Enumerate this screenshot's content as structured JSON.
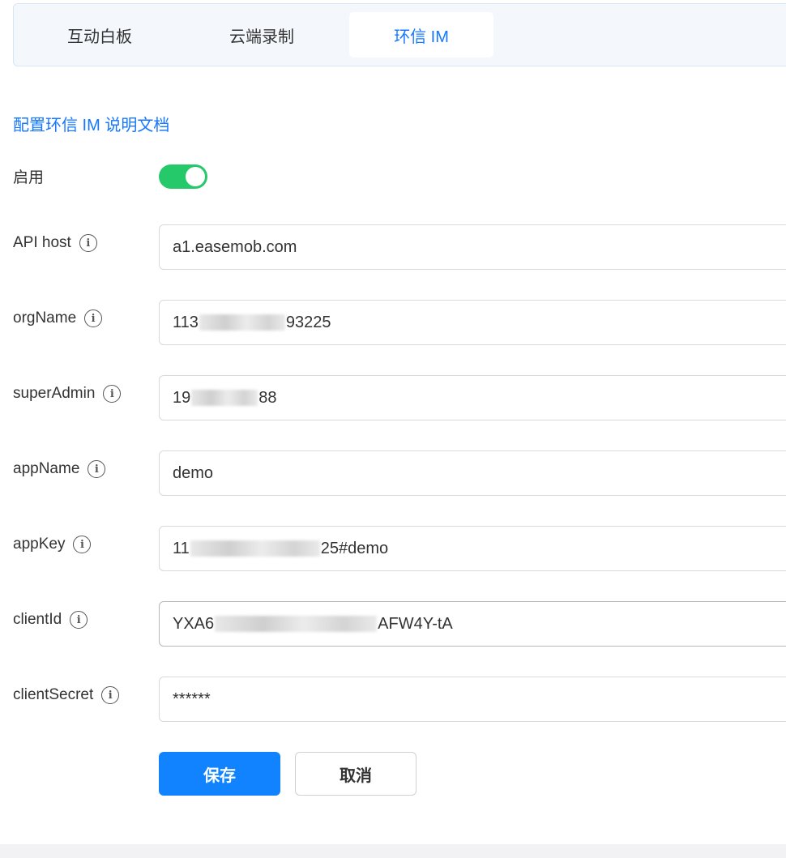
{
  "tabs": [
    {
      "label": "互动白板",
      "active": false
    },
    {
      "label": "云端录制",
      "active": false
    },
    {
      "label": "环信 IM",
      "active": true
    }
  ],
  "doc_link": "配置环信 IM 说明文档",
  "enable": {
    "label": "启用",
    "on": true
  },
  "fields": {
    "api_host": {
      "label": "API host",
      "prefix": "a1.easemob.com",
      "suffix": ""
    },
    "org_name": {
      "label": "orgName",
      "prefix": "113",
      "suffix": "93225"
    },
    "super_admin": {
      "label": "superAdmin",
      "prefix": "19",
      "suffix": "88"
    },
    "app_name": {
      "label": "appName",
      "prefix": "demo",
      "suffix": ""
    },
    "app_key": {
      "label": "appKey",
      "prefix": "11",
      "suffix": "25#demo"
    },
    "client_id": {
      "label": "clientId",
      "prefix": "YXA6",
      "suffix": "AFW4Y-tA"
    },
    "client_secret": {
      "label": "clientSecret",
      "prefix": "******",
      "suffix": ""
    }
  },
  "info_icon_glyph": "i",
  "buttons": {
    "save": "保存",
    "cancel": "取消"
  },
  "colors": {
    "accent": "#1677ff",
    "toggle_on": "#26c96a",
    "save_button": "#1283ff"
  }
}
